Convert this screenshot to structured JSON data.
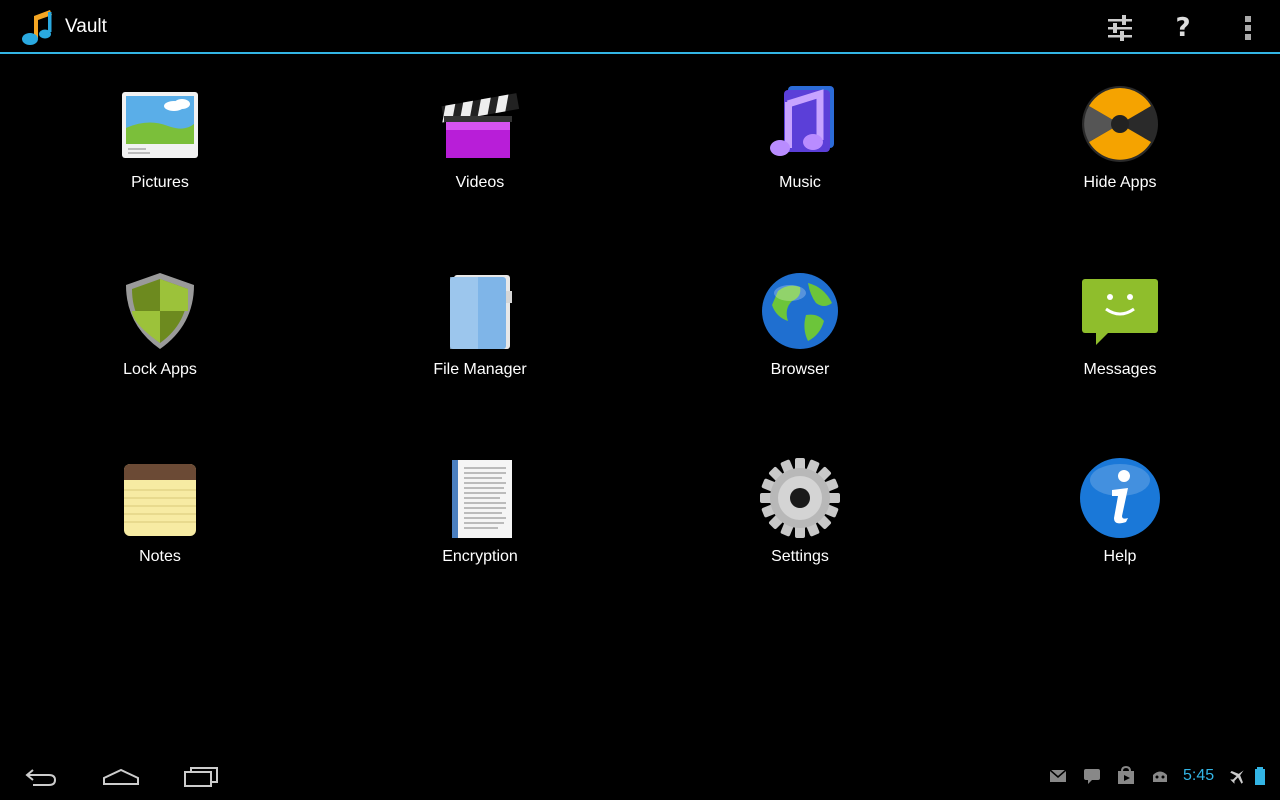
{
  "app": {
    "title": "Vault",
    "accent_color": "#33b5e5"
  },
  "action_bar": {
    "icons": [
      "settings-sliders-icon",
      "help-icon",
      "overflow-menu-icon"
    ],
    "help_glyph": "?"
  },
  "tiles": [
    {
      "label": "Pictures",
      "icon": "pictures-icon"
    },
    {
      "label": "Videos",
      "icon": "videos-icon"
    },
    {
      "label": "Music",
      "icon": "music-icon"
    },
    {
      "label": "Hide Apps",
      "icon": "hide-apps-icon"
    },
    {
      "label": "Lock Apps",
      "icon": "lock-apps-icon"
    },
    {
      "label": "File Manager",
      "icon": "file-manager-icon"
    },
    {
      "label": "Browser",
      "icon": "browser-icon"
    },
    {
      "label": "Messages",
      "icon": "messages-icon"
    },
    {
      "label": "Notes",
      "icon": "notes-icon"
    },
    {
      "label": "Encryption",
      "icon": "encryption-icon"
    },
    {
      "label": "Settings",
      "icon": "settings-icon"
    },
    {
      "label": "Help",
      "icon": "help-info-icon"
    }
  ],
  "nav_bar": {
    "buttons": [
      "back-icon",
      "home-icon",
      "recent-apps-icon"
    ]
  },
  "status_bar": {
    "time": "5:45",
    "icons": [
      "gmail-icon",
      "talk-icon",
      "play-store-icon",
      "android-debug-icon",
      "airplane-mode-icon",
      "battery-icon"
    ]
  }
}
